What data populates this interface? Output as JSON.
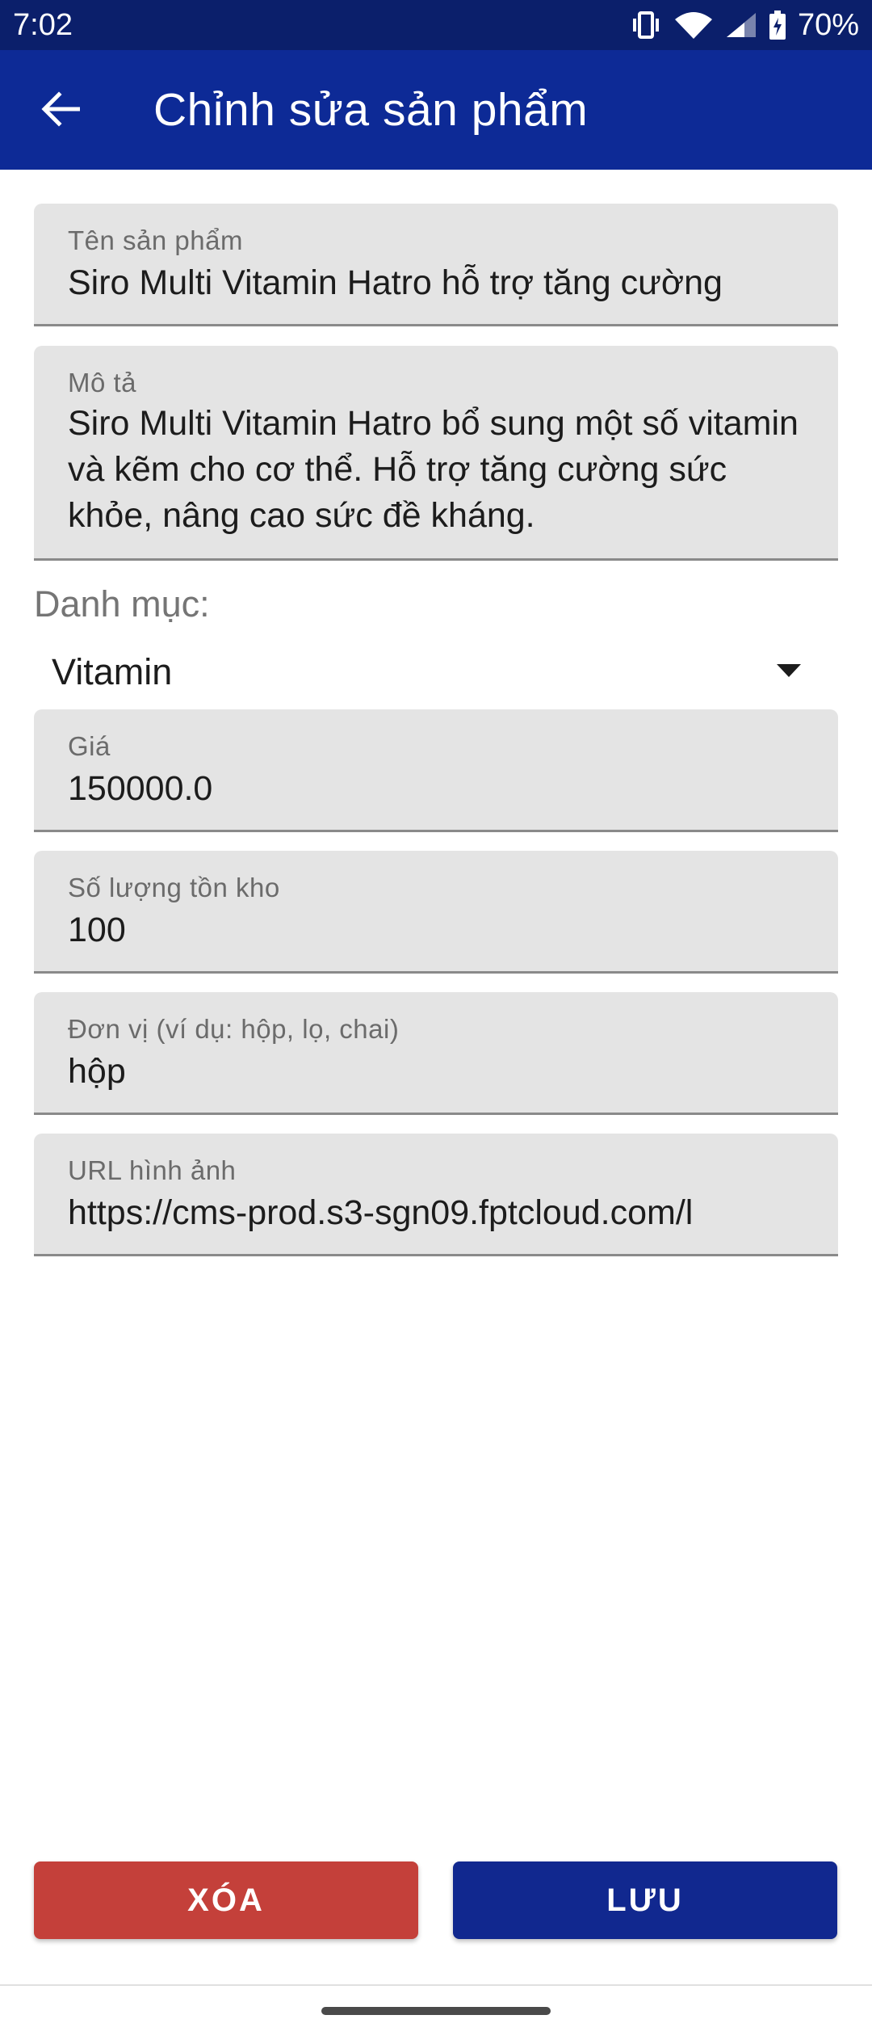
{
  "status_bar": {
    "time": "7:02",
    "battery": "70%"
  },
  "app_bar": {
    "title": "Chỉnh sửa sản phẩm",
    "back_icon": "arrow-back-icon"
  },
  "form": {
    "name": {
      "label": "Tên sản phẩm",
      "value": "Siro Multi Vitamin Hatro hỗ trợ tăng cường"
    },
    "description": {
      "label": "Mô tả",
      "value": "Siro Multi Vitamin Hatro bổ sung một số vitamin và kẽm cho cơ thể. Hỗ trợ tăng cường sức khỏe, nâng cao sức đề kháng."
    },
    "category": {
      "label": "Danh mục:",
      "selected": "Vitamin"
    },
    "price": {
      "label": "Giá",
      "value": "150000.0"
    },
    "stock": {
      "label": "Số lượng tồn kho",
      "value": "100"
    },
    "unit": {
      "label": "Đơn vị (ví dụ: hộp, lọ, chai)",
      "value": "hộp"
    },
    "image_url": {
      "label": "URL hình ảnh",
      "value": "https://cms-prod.s3-sgn09.fptcloud.com/l"
    }
  },
  "actions": {
    "delete_label": "XÓA",
    "save_label": "LƯU"
  },
  "colors": {
    "status_bar": "#0b1f6b",
    "app_bar": "#0d2a96",
    "delete_button": "#c4403a",
    "save_button": "#11288f",
    "field_background": "#e4e4e4"
  }
}
